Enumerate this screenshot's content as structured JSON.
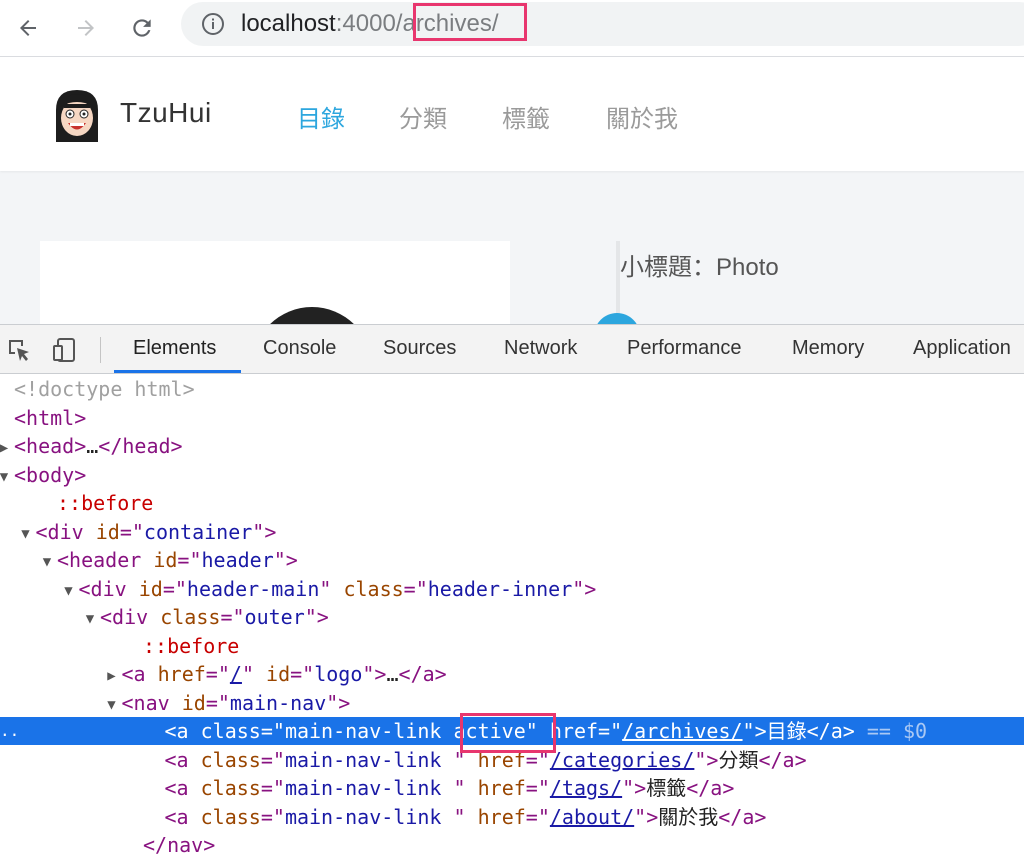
{
  "browser": {
    "url_host": "localhost",
    "url_port": ":4000",
    "url_path": "/archives/"
  },
  "site": {
    "title": "TzuHui",
    "nav": [
      {
        "label": "目錄",
        "active": true
      },
      {
        "label": "分類",
        "active": false
      },
      {
        "label": "標籤",
        "active": false
      },
      {
        "label": "關於我",
        "active": false
      }
    ],
    "subtitle": "小標題：Photo"
  },
  "devtools": {
    "tabs": [
      "Elements",
      "Console",
      "Sources",
      "Network",
      "Performance",
      "Memory",
      "Application"
    ],
    "active_tab": "Elements",
    "lines": [
      {
        "indent": 0,
        "tri": "",
        "html": [
          [
            "gray",
            "<!doctype html>"
          ]
        ]
      },
      {
        "indent": 0,
        "tri": "",
        "html": [
          [
            "tag",
            "<html>"
          ]
        ]
      },
      {
        "indent": 0,
        "tri": "▶",
        "html": [
          [
            "tag",
            "<head>"
          ],
          [
            "txt",
            "…"
          ],
          [
            "tag",
            "</head>"
          ]
        ]
      },
      {
        "indent": 0,
        "tri": "▼",
        "html": [
          [
            "tag",
            "<body>"
          ]
        ]
      },
      {
        "indent": 2,
        "tri": "",
        "html": [
          [
            "pseudo",
            "::before"
          ]
        ]
      },
      {
        "indent": 1,
        "tri": "▼",
        "html": [
          [
            "tag",
            "<div "
          ],
          [
            "attr",
            "id"
          ],
          [
            "tag",
            "=\""
          ],
          [
            "val",
            "container"
          ],
          [
            "tag",
            "\">"
          ]
        ]
      },
      {
        "indent": 2,
        "tri": "▼",
        "html": [
          [
            "tag",
            "<header "
          ],
          [
            "attr",
            "id"
          ],
          [
            "tag",
            "=\""
          ],
          [
            "val",
            "header"
          ],
          [
            "tag",
            "\">"
          ]
        ]
      },
      {
        "indent": 3,
        "tri": "▼",
        "html": [
          [
            "tag",
            "<div "
          ],
          [
            "attr",
            "id"
          ],
          [
            "tag",
            "=\""
          ],
          [
            "val",
            "header-main"
          ],
          [
            "tag",
            "\" "
          ],
          [
            "attr",
            "class"
          ],
          [
            "tag",
            "=\""
          ],
          [
            "val",
            "header-inner"
          ],
          [
            "tag",
            "\">"
          ]
        ]
      },
      {
        "indent": 4,
        "tri": "▼",
        "html": [
          [
            "tag",
            "<div "
          ],
          [
            "attr",
            "class"
          ],
          [
            "tag",
            "=\""
          ],
          [
            "val",
            "outer"
          ],
          [
            "tag",
            "\">"
          ]
        ]
      },
      {
        "indent": 6,
        "tri": "",
        "html": [
          [
            "pseudo",
            "::before"
          ]
        ]
      },
      {
        "indent": 5,
        "tri": "▶",
        "html": [
          [
            "tag",
            "<a "
          ],
          [
            "attr",
            "href"
          ],
          [
            "tag",
            "=\""
          ],
          [
            "link",
            "/"
          ],
          [
            "tag",
            "\" "
          ],
          [
            "attr",
            "id"
          ],
          [
            "tag",
            "=\""
          ],
          [
            "val",
            "logo"
          ],
          [
            "tag",
            "\">"
          ],
          [
            "txt",
            "…"
          ],
          [
            "tag",
            "</a>"
          ]
        ]
      },
      {
        "indent": 5,
        "tri": "▼",
        "html": [
          [
            "tag",
            "<nav "
          ],
          [
            "attr",
            "id"
          ],
          [
            "tag",
            "=\""
          ],
          [
            "val",
            "main-nav"
          ],
          [
            "tag",
            "\">"
          ]
        ]
      },
      {
        "indent": 7,
        "tri": "",
        "selected": true,
        "html": [
          [
            "tag",
            "<a "
          ],
          [
            "attr",
            "class"
          ],
          [
            "tag",
            "=\""
          ],
          [
            "val",
            "main-nav-link active"
          ],
          [
            "tag",
            "\" "
          ],
          [
            "attr",
            "href"
          ],
          [
            "tag",
            "=\""
          ],
          [
            "link",
            "/archives/"
          ],
          [
            "tag",
            "\">"
          ],
          [
            "txt",
            "目錄"
          ],
          [
            "tag",
            "</a>"
          ],
          [
            "dim0",
            " == $0"
          ]
        ]
      },
      {
        "indent": 7,
        "tri": "",
        "html": [
          [
            "tag",
            "<a "
          ],
          [
            "attr",
            "class"
          ],
          [
            "tag",
            "=\""
          ],
          [
            "val",
            "main-nav-link "
          ],
          [
            "tag",
            "\" "
          ],
          [
            "attr",
            "href"
          ],
          [
            "tag",
            "=\""
          ],
          [
            "link",
            "/categories/"
          ],
          [
            "tag",
            "\">"
          ],
          [
            "txt",
            "分類"
          ],
          [
            "tag",
            "</a>"
          ]
        ]
      },
      {
        "indent": 7,
        "tri": "",
        "html": [
          [
            "tag",
            "<a "
          ],
          [
            "attr",
            "class"
          ],
          [
            "tag",
            "=\""
          ],
          [
            "val",
            "main-nav-link "
          ],
          [
            "tag",
            "\" "
          ],
          [
            "attr",
            "href"
          ],
          [
            "tag",
            "=\""
          ],
          [
            "link",
            "/tags/"
          ],
          [
            "tag",
            "\">"
          ],
          [
            "txt",
            "標籤"
          ],
          [
            "tag",
            "</a>"
          ]
        ]
      },
      {
        "indent": 7,
        "tri": "",
        "html": [
          [
            "tag",
            "<a "
          ],
          [
            "attr",
            "class"
          ],
          [
            "tag",
            "=\""
          ],
          [
            "val",
            "main-nav-link "
          ],
          [
            "tag",
            "\" "
          ],
          [
            "attr",
            "href"
          ],
          [
            "tag",
            "=\""
          ],
          [
            "link",
            "/about/"
          ],
          [
            "tag",
            "\">"
          ],
          [
            "txt",
            "關於我"
          ],
          [
            "tag",
            "</a>"
          ]
        ]
      },
      {
        "indent": 6,
        "tri": "",
        "html": [
          [
            "tag",
            "</nav>"
          ]
        ]
      }
    ]
  }
}
